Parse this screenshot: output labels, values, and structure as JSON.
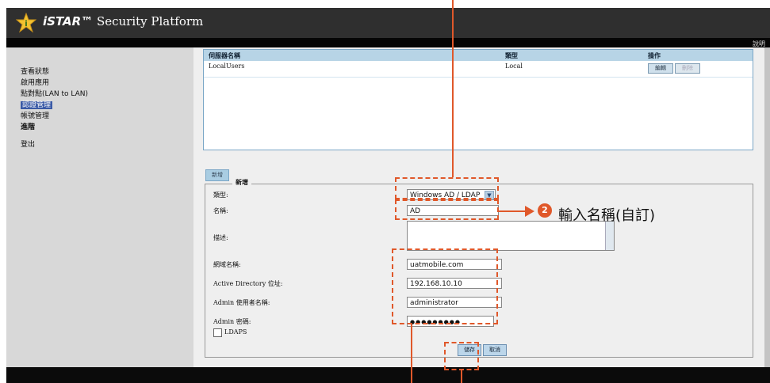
{
  "app": {
    "brand_mark": "iSTAR™",
    "brand_name": "Security Platform",
    "help_label": "說明"
  },
  "sidebar": {
    "items": [
      {
        "label": "查看狀態"
      },
      {
        "label": "啟用應用"
      },
      {
        "label": "點對點(LAN to LAN)"
      },
      {
        "label": "認證管理",
        "active": true
      },
      {
        "label": "帳號管理"
      },
      {
        "label": "進階"
      },
      {
        "label": "登出"
      }
    ]
  },
  "server_table": {
    "headers": [
      "伺服器名稱",
      "類型",
      "操作"
    ],
    "rows": [
      {
        "name": "LocalUsers",
        "type": "Local",
        "edit_label": "編輯",
        "delete_label": "刪除"
      }
    ]
  },
  "add_button": "新增",
  "form": {
    "legend": "新增",
    "type_label": "類型:",
    "type_value": "Windows AD / LDAP",
    "name_label": "名稱:",
    "name_value": "AD",
    "desc_label": "描述:",
    "desc_value": "",
    "domain_label": "網域名稱:",
    "domain_value": "uatmobile.com",
    "ad_ip_label": "Active Directory 位址:",
    "ad_ip_value": "192.168.10.10",
    "admin_user_label": "Admin 使用者名稱:",
    "admin_user_value": "administrator",
    "admin_pwd_label": "Admin 密碼:",
    "admin_pwd_value": "●●●●●●●●●",
    "ldaps_label": "LDAPS",
    "save_label": "儲存",
    "cancel_label": "取消"
  },
  "annotation": {
    "step_number": "2",
    "text": "輸入名稱(自訂)",
    "color": "#e0582a"
  }
}
